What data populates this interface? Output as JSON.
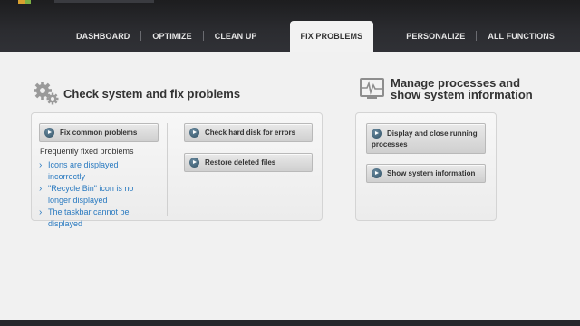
{
  "nav": {
    "items": [
      "DASHBOARD",
      "OPTIMIZE",
      "CLEAN UP",
      "FIX PROBLEMS",
      "PERSONALIZE",
      "ALL FUNCTIONS"
    ],
    "active": "FIX PROBLEMS"
  },
  "left_section": {
    "title": "Check system and fix problems",
    "icon": "gears-icon",
    "fix_common_button": "Fix common problems",
    "frequently_fixed_label": "Frequently fixed problems",
    "problems": [
      "Icons are displayed incorrectly",
      "\"Recycle Bin\" icon is no longer displayed",
      "The taskbar cannot be displayed"
    ],
    "check_disk_button": "Check hard disk for errors",
    "restore_files_button": "Restore deleted files"
  },
  "right_section": {
    "title_line1": "Manage processes and",
    "title_line2": "show system information",
    "icon": "monitor-pulse-icon",
    "running_processes_line1": "Display and close running",
    "running_processes_line2": "processes",
    "system_info_button": "Show system information"
  },
  "colors": {
    "link": "#2a7ac0",
    "topbar": "#2b2c30",
    "background": "#f1f1f1"
  }
}
